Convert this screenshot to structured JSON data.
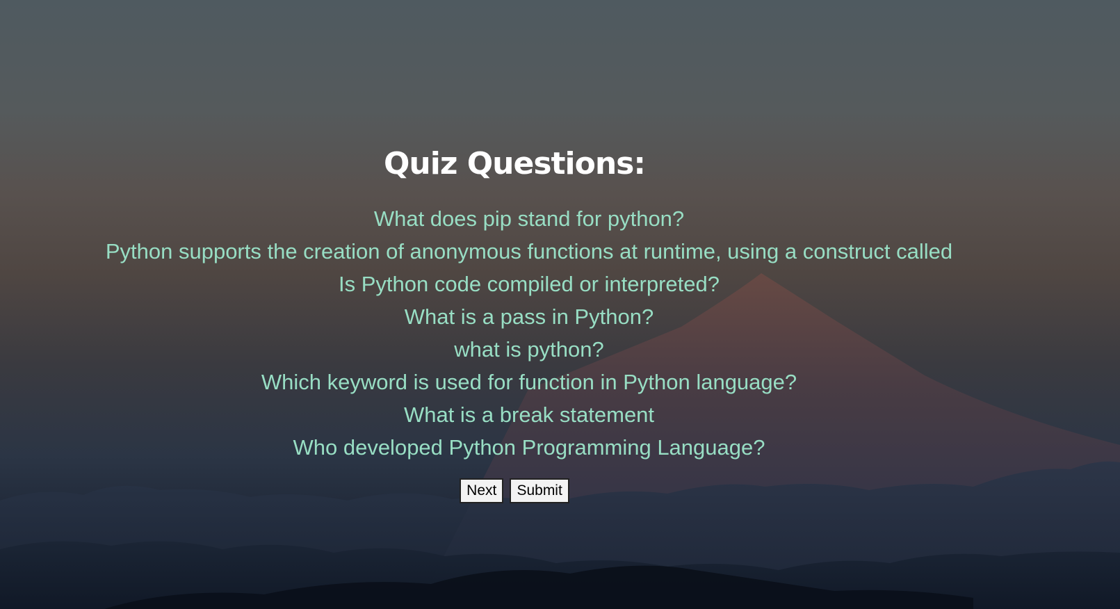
{
  "quiz": {
    "title": "Quiz Questions:",
    "questions": [
      "What does pip stand for python?",
      "Python supports the creation of anonymous functions at runtime, using a construct called",
      "Is Python code compiled or interpreted?",
      "What is a pass in Python?",
      "what is python?",
      "Which keyword is used for function in Python language?",
      "What is a break statement",
      "Who developed Python Programming Language?"
    ],
    "buttons": {
      "next_label": "Next",
      "submit_label": "Submit"
    }
  },
  "colors": {
    "title": "#ffffff",
    "question": "#98dec4",
    "button_bg": "#f3f3f3"
  },
  "background": {
    "icon": "mountain-landscape-image"
  }
}
